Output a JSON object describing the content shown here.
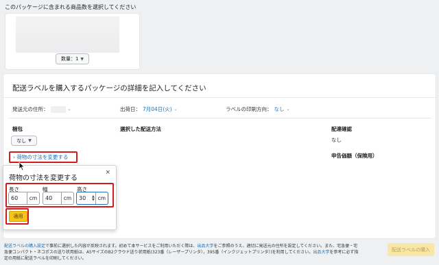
{
  "top_instruction": "このパッケージに含まれる商品数を選択してください",
  "quantity_select": {
    "value": "数量：1"
  },
  "main": {
    "title": "配送ラベルを購入するパッケージの詳細を記入してください",
    "ship_from_label": "発送元の住所：",
    "ship_date_label": "出荷日：",
    "ship_date_value": "7月04日(火)",
    "print_orientation_label": "ラベルの印刷方向：",
    "print_orientation_value": "なし",
    "packaging_header": "梱包",
    "packaging_value": "なし",
    "shipping_method_header": "選択した配送方法",
    "delivery_confirm_header": "配達確認",
    "delivery_confirm_value": "なし",
    "declared_value_header": "申告価額（保険用）",
    "change_dimensions_link": "荷物の寸法を変更する"
  },
  "popup": {
    "title": "荷物の寸法を変更する",
    "close": "×",
    "length_label": "長さ",
    "width_label": "幅",
    "height_label": "高さ",
    "length_value": "60",
    "width_value": "40",
    "height_value": "30",
    "unit": "cm",
    "apply_label": "適用"
  },
  "footer": {
    "link1": "配送ラベルの購入設定",
    "text1": "で事前に選択した内容が反映されます。初めて本サービスをご利用いただく際は、",
    "link2": "出品大学",
    "text2": "をご参照のうえ、適切に発送元の住所を設定してください。また、宅急便・宅急便コンパクト・ネコポスの送り状用紙は、A5サイズのB2クラウド送り状用紙(323番（レーザープリンタ），395番（インクジェットプリンタ）)を利用してください。",
    "link3": "出品大学",
    "text3": "を参考に必ず指定の用紙に配送ラベルを印刷してください。"
  },
  "buy_button_label": "配送ラベルの購入",
  "colors": {
    "highlight": "#d11b1b",
    "link": "#1f6fb2",
    "apply": "#f5c518"
  }
}
